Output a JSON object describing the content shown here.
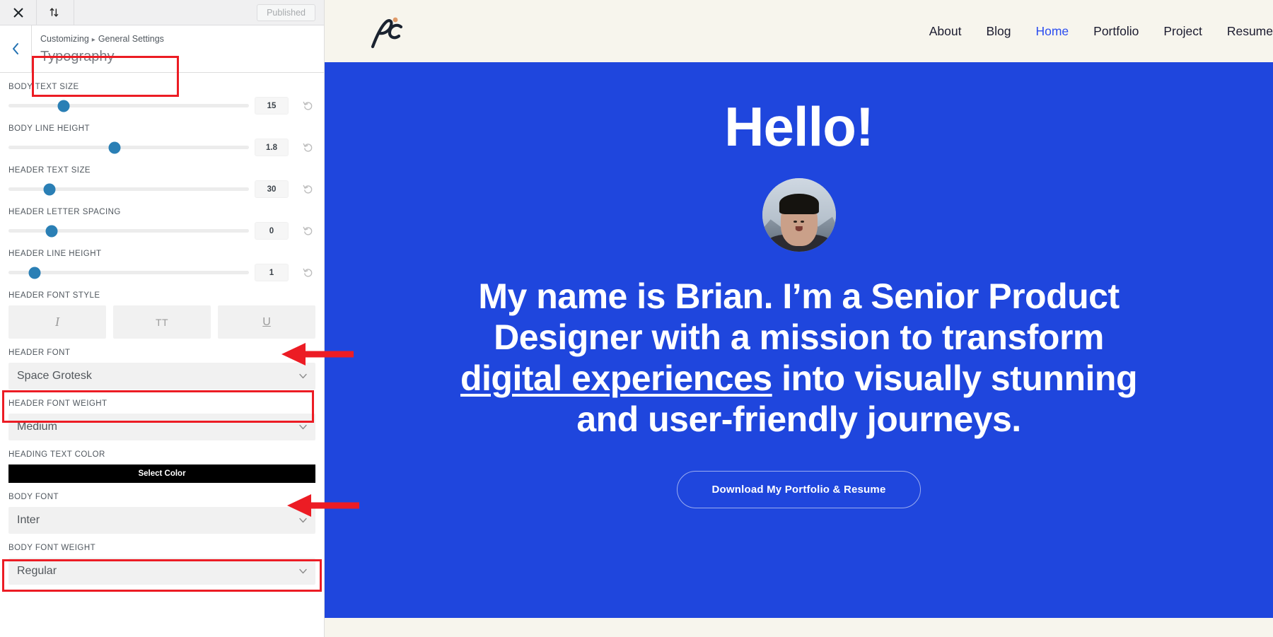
{
  "customizer": {
    "topbar": {
      "close_icon": "close-icon",
      "devices_icon": "device-switch-icon",
      "published_label": "Published"
    },
    "header": {
      "back_icon": "chevron-left-icon",
      "breadcrumb_root": "Customizing",
      "breadcrumb_separator": "▸",
      "breadcrumb_section": "General Settings",
      "panel_title": "Typography"
    },
    "sliders": [
      {
        "label": "BODY TEXT SIZE",
        "value": "15",
        "thumb_pct": 23,
        "reset_icon": "undo-icon"
      },
      {
        "label": "BODY LINE HEIGHT",
        "value": "1.8",
        "thumb_pct": 44,
        "reset_icon": "undo-icon"
      },
      {
        "label": "HEADER TEXT SIZE",
        "value": "30",
        "thumb_pct": 17,
        "reset_icon": "undo-icon"
      },
      {
        "label": "HEADER LETTER SPACING",
        "value": "0",
        "thumb_pct": 18,
        "reset_icon": "undo-icon"
      },
      {
        "label": "HEADER LINE HEIGHT",
        "value": "1",
        "thumb_pct": 11,
        "reset_icon": "undo-icon"
      }
    ],
    "font_style": {
      "label": "HEADER FONT STYLE",
      "buttons": [
        {
          "name": "italic-button",
          "glyph": "I"
        },
        {
          "name": "uppercase-button",
          "glyph": "TT"
        },
        {
          "name": "underline-button",
          "glyph": "U"
        }
      ]
    },
    "header_font": {
      "label": "HEADER FONT",
      "value": "Space Grotesk"
    },
    "header_font_weight": {
      "label": "HEADER FONT WEIGHT",
      "value": "Medium"
    },
    "heading_text_color": {
      "label": "HEADING TEXT COLOR",
      "button_label": "Select Color",
      "swatch": "#000000"
    },
    "body_font": {
      "label": "BODY FONT",
      "value": "Inter"
    },
    "body_font_weight": {
      "label": "BODY FONT WEIGHT",
      "value": "Regular"
    }
  },
  "annotations": {
    "highlight_color": "#ec1c24",
    "boxes": [
      "panel-title",
      "header-font-select",
      "body-font-select"
    ],
    "arrows": [
      "arrow-to-header-font",
      "arrow-to-body-font"
    ]
  },
  "preview": {
    "logo": {
      "name": "pc-monogram-logo",
      "text": "pc"
    },
    "nav": [
      {
        "label": "About",
        "active": false
      },
      {
        "label": "Blog",
        "active": false
      },
      {
        "label": "Home",
        "active": true
      },
      {
        "label": "Portfolio",
        "active": false
      },
      {
        "label": "Project",
        "active": false
      },
      {
        "label": "Resume",
        "active": false
      }
    ],
    "hero": {
      "greeting": "Hello!",
      "avatar_name": "profile-avatar",
      "paragraph_part1": "My name is Brian. I’m a Senior Product\nDesigner with a mission to transform\n",
      "paragraph_underlined": "digital experiences",
      "paragraph_part2": " into visually stunning\nand user-friendly journeys.",
      "cta_label": "Download My Portfolio & Resume",
      "background_color": "#1f46dd",
      "accent_color": "#2b4df0"
    },
    "page_background": "#f7f5ed"
  }
}
